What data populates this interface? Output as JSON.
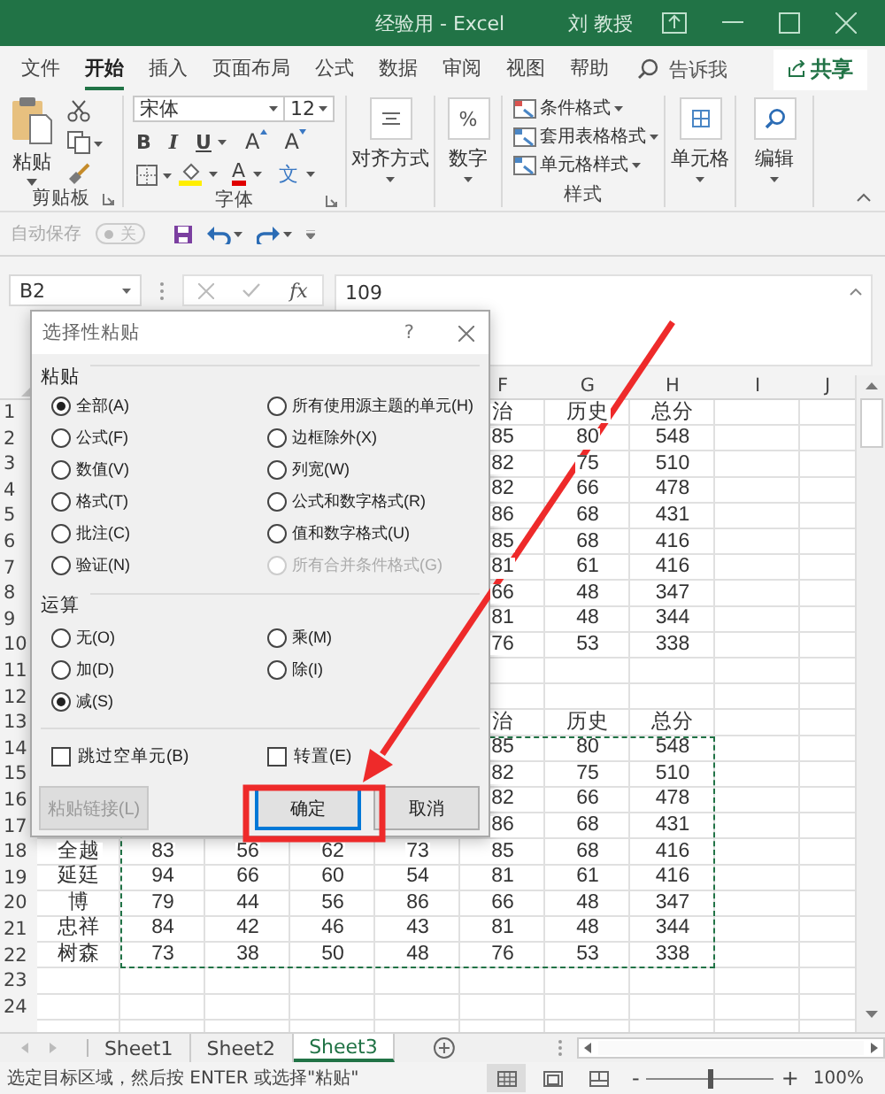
{
  "window": {
    "title": "经验用 - Excel",
    "user": "刘 教授"
  },
  "ribbon_tabs": [
    {
      "label": "文件",
      "selected": false
    },
    {
      "label": "开始",
      "selected": true
    },
    {
      "label": "插入",
      "selected": false
    },
    {
      "label": "页面布局",
      "selected": false
    },
    {
      "label": "公式",
      "selected": false
    },
    {
      "label": "数据",
      "selected": false
    },
    {
      "label": "审阅",
      "selected": false
    },
    {
      "label": "视图",
      "selected": false
    },
    {
      "label": "帮助",
      "selected": false
    }
  ],
  "tell_me": "告诉我",
  "share_button": "共享",
  "ribbon": {
    "clipboard": {
      "paste": "粘贴",
      "label": "剪贴板"
    },
    "font": {
      "name": "宋体",
      "size": "12",
      "styles": [
        "B",
        "I",
        "U"
      ],
      "grow": "A",
      "shrink": "A",
      "color_letter": "A",
      "phonetic": "文",
      "label": "字体"
    },
    "alignment": "对齐方式",
    "number": {
      "symbol": "%",
      "label": "数字"
    },
    "styles": {
      "items": [
        "条件格式",
        "套用表格格式",
        "单元格样式"
      ],
      "label": "样式"
    },
    "cells": "单元格",
    "editing": "编辑"
  },
  "quick_access": {
    "autosave": "自动保存",
    "toggle": {
      "label": "关",
      "on": false
    }
  },
  "formula_bar": {
    "name_box": "B2",
    "fx": "fx",
    "value": "109"
  },
  "sheet": {
    "columns": [
      "F",
      "G",
      "H",
      "I",
      "J"
    ],
    "rows": [
      {
        "number": "1",
        "cells": [
          "治",
          "历史",
          "总分"
        ]
      },
      {
        "number": "2",
        "cells": [
          "85",
          "80",
          "548"
        ]
      },
      {
        "number": "3",
        "cells": [
          "82",
          "75",
          "510"
        ]
      },
      {
        "number": "4",
        "cells": [
          "82",
          "66",
          "478"
        ]
      },
      {
        "number": "5",
        "cells": [
          "86",
          "68",
          "431"
        ]
      },
      {
        "number": "6",
        "cells": [
          "85",
          "68",
          "416"
        ]
      },
      {
        "number": "7",
        "cells": [
          "81",
          "61",
          "416"
        ]
      },
      {
        "number": "8",
        "cells": [
          "66",
          "48",
          "347"
        ]
      },
      {
        "number": "9",
        "cells": [
          "81",
          "48",
          "344"
        ]
      },
      {
        "number": "10",
        "cells": [
          "76",
          "53",
          "338"
        ]
      },
      {
        "number": "11"
      },
      {
        "number": "12"
      },
      {
        "number": "13",
        "cells": [
          "治",
          "历史",
          "总分"
        ]
      },
      {
        "number": "14",
        "cells": [
          "85",
          "80",
          "548"
        ]
      },
      {
        "number": "15",
        "cells": [
          "82",
          "75",
          "510"
        ]
      },
      {
        "number": "16",
        "cells": [
          "82",
          "66",
          "478"
        ]
      },
      {
        "number": "17",
        "cells": [
          "86",
          "68",
          "431"
        ]
      },
      {
        "number": "18",
        "cells": [
          "全越",
          "83",
          "56",
          "62",
          "73",
          "85",
          "68",
          "416"
        ]
      },
      {
        "number": "19",
        "cells": [
          "延廷",
          "94",
          "66",
          "60",
          "54",
          "81",
          "61",
          "416"
        ]
      },
      {
        "number": "20",
        "cells": [
          "博",
          "79",
          "44",
          "56",
          "86",
          "66",
          "48",
          "347"
        ]
      },
      {
        "number": "21",
        "cells": [
          "忠祥",
          "84",
          "42",
          "46",
          "43",
          "81",
          "48",
          "344"
        ]
      },
      {
        "number": "22",
        "cells": [
          "树森",
          "73",
          "38",
          "50",
          "48",
          "76",
          "53",
          "338"
        ]
      },
      {
        "number": "23"
      },
      {
        "number": "24"
      }
    ]
  },
  "sheet_tabs": [
    {
      "label": "Sheet1",
      "selected": false
    },
    {
      "label": "Sheet2",
      "selected": false
    },
    {
      "label": "Sheet3",
      "selected": true
    }
  ],
  "status_bar": {
    "message": "选定目标区域，然后按 ENTER 或选择\"粘贴\"",
    "views": [
      {
        "kind": "normal",
        "selected": true
      },
      {
        "kind": "page_layout",
        "selected": false
      },
      {
        "kind": "page_break",
        "selected": false
      }
    ],
    "zoom_out": "-",
    "zoom_in": "+",
    "zoom": {
      "level": 0.5
    },
    "zoom_value": "100%"
  },
  "paste_special": {
    "title": "选择性粘贴",
    "help": "?",
    "paste_label": "粘贴",
    "paste_options": [
      {
        "label": "全部(A)",
        "selected": true,
        "disabled": false
      },
      {
        "label": "公式(F)",
        "selected": false,
        "disabled": false
      },
      {
        "label": "数值(V)",
        "selected": false,
        "disabled": false
      },
      {
        "label": "格式(T)",
        "selected": false,
        "disabled": false
      },
      {
        "label": "批注(C)",
        "selected": false,
        "disabled": false
      },
      {
        "label": "验证(N)",
        "selected": false,
        "disabled": false
      },
      {
        "label": "所有使用源主题的单元(H)",
        "selected": false,
        "disabled": false
      },
      {
        "label": "边框除外(X)",
        "selected": false,
        "disabled": false
      },
      {
        "label": "列宽(W)",
        "selected": false,
        "disabled": false
      },
      {
        "label": "公式和数字格式(R)",
        "selected": false,
        "disabled": false
      },
      {
        "label": "值和数字格式(U)",
        "selected": false,
        "disabled": false
      },
      {
        "label": "所有合并条件格式(G)",
        "selected": false,
        "disabled": true
      }
    ],
    "operation_label": "运算",
    "operations": [
      {
        "label": "无(O)",
        "selected": false
      },
      {
        "label": "加(D)",
        "selected": false
      },
      {
        "label": "减(S)",
        "selected": true
      },
      {
        "label": "乘(M)",
        "selected": false
      },
      {
        "label": "除(I)",
        "selected": false
      }
    ],
    "checkboxes": [
      {
        "label": "跳过空单元(B)",
        "checked": false
      },
      {
        "label": "转置(E)",
        "checked": false
      }
    ],
    "buttons": [
      {
        "label": "粘贴链接(L)",
        "kind": "link",
        "disabled": true,
        "focused": false
      },
      {
        "label": "确定",
        "kind": "ok",
        "disabled": false,
        "focused": true
      },
      {
        "label": "取消",
        "kind": "cancel",
        "disabled": false,
        "focused": false
      }
    ]
  }
}
